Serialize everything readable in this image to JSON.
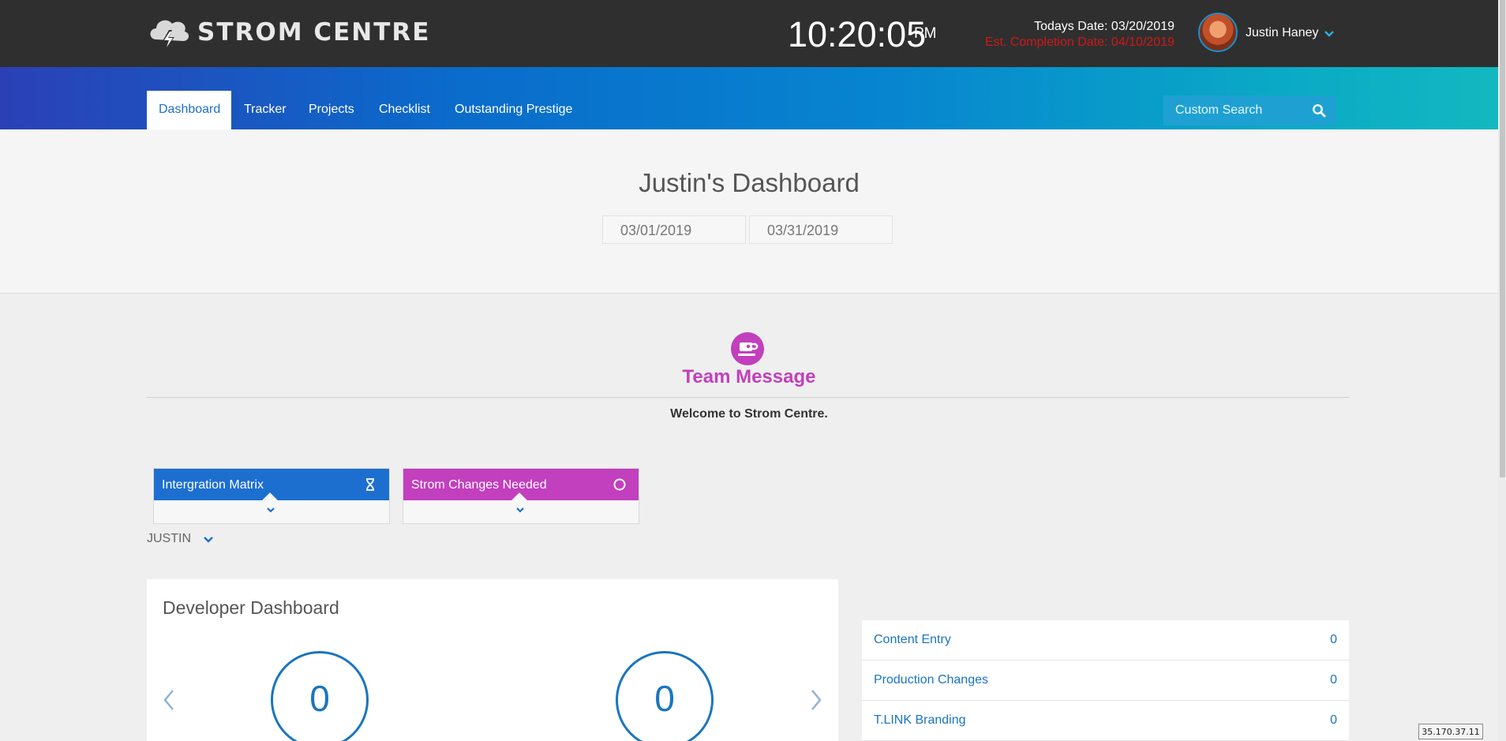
{
  "header": {
    "logo_text": "STROM CENTRE",
    "clock_time": "10:20:05",
    "clock_ampm": "PM",
    "todays_date": "Todays Date: 03/20/2019",
    "est_completion": "Est. Completion Date: 04/10/2019",
    "user_name": "Justin Haney"
  },
  "nav": {
    "items": [
      "Dashboard",
      "Tracker",
      "Projects",
      "Checklist",
      "Outstanding Prestige"
    ],
    "active": "Dashboard",
    "search_placeholder": "Custom Search"
  },
  "dashboard": {
    "title": "Justin's Dashboard",
    "date_from": "03/01/2019",
    "date_to": "03/31/2019"
  },
  "team_message": {
    "title": "Team Message",
    "text": "Welcome to Strom Centre."
  },
  "widgets": [
    {
      "label": "Intergration Matrix",
      "icon": "hourglass-icon",
      "color": "#1d6fcf"
    },
    {
      "label": "Strom Changes Needed",
      "icon": "circle-icon",
      "color": "#c23fbe"
    }
  ],
  "user_filter": "JUSTIN",
  "developer_dashboard": {
    "title": "Developer Dashboard",
    "counts": [
      "0",
      "0"
    ]
  },
  "stats": [
    {
      "label": "Content Entry",
      "value": "0"
    },
    {
      "label": "Production Changes",
      "value": "0"
    },
    {
      "label": "T.LINK Branding",
      "value": "0"
    }
  ],
  "ip_badge": "35.170.37.11",
  "colors": {
    "header_bg": "#2f2f2f",
    "primary_blue": "#1d6fcf",
    "magenta": "#c23fbe",
    "alert_red": "#d01818"
  }
}
